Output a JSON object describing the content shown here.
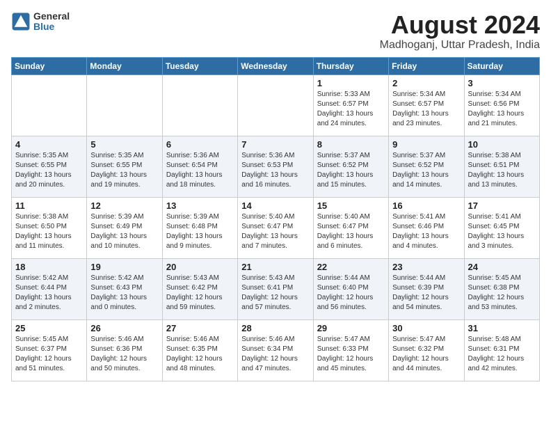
{
  "logo": {
    "general": "General",
    "blue": "Blue"
  },
  "header": {
    "title": "August 2024",
    "subtitle": "Madhoganj, Uttar Pradesh, India"
  },
  "weekdays": [
    "Sunday",
    "Monday",
    "Tuesday",
    "Wednesday",
    "Thursday",
    "Friday",
    "Saturday"
  ],
  "weeks": [
    [
      {
        "day": "",
        "info": ""
      },
      {
        "day": "",
        "info": ""
      },
      {
        "day": "",
        "info": ""
      },
      {
        "day": "",
        "info": ""
      },
      {
        "day": "1",
        "info": "Sunrise: 5:33 AM\nSunset: 6:57 PM\nDaylight: 13 hours\nand 24 minutes."
      },
      {
        "day": "2",
        "info": "Sunrise: 5:34 AM\nSunset: 6:57 PM\nDaylight: 13 hours\nand 23 minutes."
      },
      {
        "day": "3",
        "info": "Sunrise: 5:34 AM\nSunset: 6:56 PM\nDaylight: 13 hours\nand 21 minutes."
      }
    ],
    [
      {
        "day": "4",
        "info": "Sunrise: 5:35 AM\nSunset: 6:55 PM\nDaylight: 13 hours\nand 20 minutes."
      },
      {
        "day": "5",
        "info": "Sunrise: 5:35 AM\nSunset: 6:55 PM\nDaylight: 13 hours\nand 19 minutes."
      },
      {
        "day": "6",
        "info": "Sunrise: 5:36 AM\nSunset: 6:54 PM\nDaylight: 13 hours\nand 18 minutes."
      },
      {
        "day": "7",
        "info": "Sunrise: 5:36 AM\nSunset: 6:53 PM\nDaylight: 13 hours\nand 16 minutes."
      },
      {
        "day": "8",
        "info": "Sunrise: 5:37 AM\nSunset: 6:52 PM\nDaylight: 13 hours\nand 15 minutes."
      },
      {
        "day": "9",
        "info": "Sunrise: 5:37 AM\nSunset: 6:52 PM\nDaylight: 13 hours\nand 14 minutes."
      },
      {
        "day": "10",
        "info": "Sunrise: 5:38 AM\nSunset: 6:51 PM\nDaylight: 13 hours\nand 13 minutes."
      }
    ],
    [
      {
        "day": "11",
        "info": "Sunrise: 5:38 AM\nSunset: 6:50 PM\nDaylight: 13 hours\nand 11 minutes."
      },
      {
        "day": "12",
        "info": "Sunrise: 5:39 AM\nSunset: 6:49 PM\nDaylight: 13 hours\nand 10 minutes."
      },
      {
        "day": "13",
        "info": "Sunrise: 5:39 AM\nSunset: 6:48 PM\nDaylight: 13 hours\nand 9 minutes."
      },
      {
        "day": "14",
        "info": "Sunrise: 5:40 AM\nSunset: 6:47 PM\nDaylight: 13 hours\nand 7 minutes."
      },
      {
        "day": "15",
        "info": "Sunrise: 5:40 AM\nSunset: 6:47 PM\nDaylight: 13 hours\nand 6 minutes."
      },
      {
        "day": "16",
        "info": "Sunrise: 5:41 AM\nSunset: 6:46 PM\nDaylight: 13 hours\nand 4 minutes."
      },
      {
        "day": "17",
        "info": "Sunrise: 5:41 AM\nSunset: 6:45 PM\nDaylight: 13 hours\nand 3 minutes."
      }
    ],
    [
      {
        "day": "18",
        "info": "Sunrise: 5:42 AM\nSunset: 6:44 PM\nDaylight: 13 hours\nand 2 minutes."
      },
      {
        "day": "19",
        "info": "Sunrise: 5:42 AM\nSunset: 6:43 PM\nDaylight: 13 hours\nand 0 minutes."
      },
      {
        "day": "20",
        "info": "Sunrise: 5:43 AM\nSunset: 6:42 PM\nDaylight: 12 hours\nand 59 minutes."
      },
      {
        "day": "21",
        "info": "Sunrise: 5:43 AM\nSunset: 6:41 PM\nDaylight: 12 hours\nand 57 minutes."
      },
      {
        "day": "22",
        "info": "Sunrise: 5:44 AM\nSunset: 6:40 PM\nDaylight: 12 hours\nand 56 minutes."
      },
      {
        "day": "23",
        "info": "Sunrise: 5:44 AM\nSunset: 6:39 PM\nDaylight: 12 hours\nand 54 minutes."
      },
      {
        "day": "24",
        "info": "Sunrise: 5:45 AM\nSunset: 6:38 PM\nDaylight: 12 hours\nand 53 minutes."
      }
    ],
    [
      {
        "day": "25",
        "info": "Sunrise: 5:45 AM\nSunset: 6:37 PM\nDaylight: 12 hours\nand 51 minutes."
      },
      {
        "day": "26",
        "info": "Sunrise: 5:46 AM\nSunset: 6:36 PM\nDaylight: 12 hours\nand 50 minutes."
      },
      {
        "day": "27",
        "info": "Sunrise: 5:46 AM\nSunset: 6:35 PM\nDaylight: 12 hours\nand 48 minutes."
      },
      {
        "day": "28",
        "info": "Sunrise: 5:46 AM\nSunset: 6:34 PM\nDaylight: 12 hours\nand 47 minutes."
      },
      {
        "day": "29",
        "info": "Sunrise: 5:47 AM\nSunset: 6:33 PM\nDaylight: 12 hours\nand 45 minutes."
      },
      {
        "day": "30",
        "info": "Sunrise: 5:47 AM\nSunset: 6:32 PM\nDaylight: 12 hours\nand 44 minutes."
      },
      {
        "day": "31",
        "info": "Sunrise: 5:48 AM\nSunset: 6:31 PM\nDaylight: 12 hours\nand 42 minutes."
      }
    ]
  ]
}
